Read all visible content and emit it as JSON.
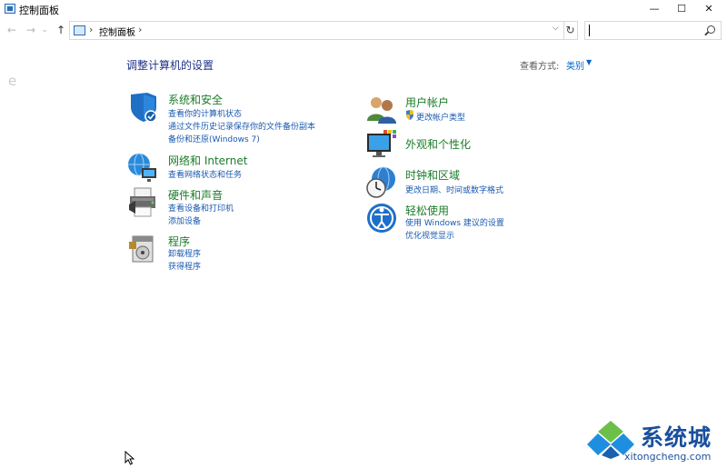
{
  "window": {
    "title": "控制面板",
    "minimize": "—",
    "maximize": "☐",
    "close": "✕"
  },
  "nav": {
    "back": "←",
    "forward": "→",
    "recent": "⌄",
    "up": "↑"
  },
  "address": {
    "sep1": "›",
    "path": "控制面板",
    "sep2": "›",
    "dropdown": "⌵",
    "refresh": "↻"
  },
  "search": {
    "placeholder": ""
  },
  "content": {
    "heading": "调整计算机的设置",
    "view_by_label": "查看方式:",
    "view_by_value": "类别",
    "view_by_arrow": "▼"
  },
  "categories": {
    "system": {
      "title": "系统和安全",
      "links": [
        "查看你的计算机状态",
        "通过文件历史记录保存你的文件备份副本",
        "备份和还原(Windows 7)"
      ]
    },
    "network": {
      "title": "网络和 Internet",
      "links": [
        "查看网络状态和任务"
      ]
    },
    "hardware": {
      "title": "硬件和声音",
      "links": [
        "查看设备和打印机",
        "添加设备"
      ]
    },
    "programs": {
      "title": "程序",
      "links": [
        "卸载程序",
        "获得程序"
      ]
    },
    "users": {
      "title": "用户帐户",
      "links": [
        "更改帐户类型"
      ]
    },
    "appearance": {
      "title": "外观和个性化",
      "links": []
    },
    "clock": {
      "title": "时钟和区域",
      "links": [
        "更改日期、时间或数字格式"
      ]
    },
    "ease": {
      "title": "轻松使用",
      "links": [
        "使用 Windows 建议的设置",
        "优化视觉显示"
      ]
    }
  },
  "watermark": {
    "text": "系统城",
    "url": "xitongcheng.com"
  }
}
